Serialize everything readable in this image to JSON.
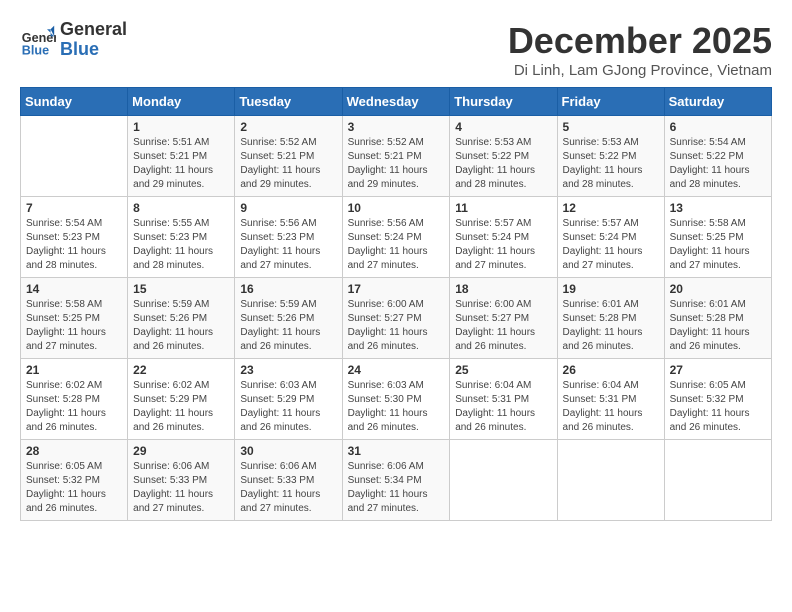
{
  "logo": {
    "general": "General",
    "blue": "Blue"
  },
  "title": "December 2025",
  "subtitle": "Di Linh, Lam GJong Province, Vietnam",
  "headers": [
    "Sunday",
    "Monday",
    "Tuesday",
    "Wednesday",
    "Thursday",
    "Friday",
    "Saturday"
  ],
  "weeks": [
    [
      {
        "day": "",
        "info": ""
      },
      {
        "day": "1",
        "info": "Sunrise: 5:51 AM\nSunset: 5:21 PM\nDaylight: 11 hours and 29 minutes."
      },
      {
        "day": "2",
        "info": "Sunrise: 5:52 AM\nSunset: 5:21 PM\nDaylight: 11 hours and 29 minutes."
      },
      {
        "day": "3",
        "info": "Sunrise: 5:52 AM\nSunset: 5:21 PM\nDaylight: 11 hours and 29 minutes."
      },
      {
        "day": "4",
        "info": "Sunrise: 5:53 AM\nSunset: 5:22 PM\nDaylight: 11 hours and 28 minutes."
      },
      {
        "day": "5",
        "info": "Sunrise: 5:53 AM\nSunset: 5:22 PM\nDaylight: 11 hours and 28 minutes."
      },
      {
        "day": "6",
        "info": "Sunrise: 5:54 AM\nSunset: 5:22 PM\nDaylight: 11 hours and 28 minutes."
      }
    ],
    [
      {
        "day": "7",
        "info": "Sunrise: 5:54 AM\nSunset: 5:23 PM\nDaylight: 11 hours and 28 minutes."
      },
      {
        "day": "8",
        "info": "Sunrise: 5:55 AM\nSunset: 5:23 PM\nDaylight: 11 hours and 28 minutes."
      },
      {
        "day": "9",
        "info": "Sunrise: 5:56 AM\nSunset: 5:23 PM\nDaylight: 11 hours and 27 minutes."
      },
      {
        "day": "10",
        "info": "Sunrise: 5:56 AM\nSunset: 5:24 PM\nDaylight: 11 hours and 27 minutes."
      },
      {
        "day": "11",
        "info": "Sunrise: 5:57 AM\nSunset: 5:24 PM\nDaylight: 11 hours and 27 minutes."
      },
      {
        "day": "12",
        "info": "Sunrise: 5:57 AM\nSunset: 5:24 PM\nDaylight: 11 hours and 27 minutes."
      },
      {
        "day": "13",
        "info": "Sunrise: 5:58 AM\nSunset: 5:25 PM\nDaylight: 11 hours and 27 minutes."
      }
    ],
    [
      {
        "day": "14",
        "info": "Sunrise: 5:58 AM\nSunset: 5:25 PM\nDaylight: 11 hours and 27 minutes."
      },
      {
        "day": "15",
        "info": "Sunrise: 5:59 AM\nSunset: 5:26 PM\nDaylight: 11 hours and 26 minutes."
      },
      {
        "day": "16",
        "info": "Sunrise: 5:59 AM\nSunset: 5:26 PM\nDaylight: 11 hours and 26 minutes."
      },
      {
        "day": "17",
        "info": "Sunrise: 6:00 AM\nSunset: 5:27 PM\nDaylight: 11 hours and 26 minutes."
      },
      {
        "day": "18",
        "info": "Sunrise: 6:00 AM\nSunset: 5:27 PM\nDaylight: 11 hours and 26 minutes."
      },
      {
        "day": "19",
        "info": "Sunrise: 6:01 AM\nSunset: 5:28 PM\nDaylight: 11 hours and 26 minutes."
      },
      {
        "day": "20",
        "info": "Sunrise: 6:01 AM\nSunset: 5:28 PM\nDaylight: 11 hours and 26 minutes."
      }
    ],
    [
      {
        "day": "21",
        "info": "Sunrise: 6:02 AM\nSunset: 5:28 PM\nDaylight: 11 hours and 26 minutes."
      },
      {
        "day": "22",
        "info": "Sunrise: 6:02 AM\nSunset: 5:29 PM\nDaylight: 11 hours and 26 minutes."
      },
      {
        "day": "23",
        "info": "Sunrise: 6:03 AM\nSunset: 5:29 PM\nDaylight: 11 hours and 26 minutes."
      },
      {
        "day": "24",
        "info": "Sunrise: 6:03 AM\nSunset: 5:30 PM\nDaylight: 11 hours and 26 minutes."
      },
      {
        "day": "25",
        "info": "Sunrise: 6:04 AM\nSunset: 5:31 PM\nDaylight: 11 hours and 26 minutes."
      },
      {
        "day": "26",
        "info": "Sunrise: 6:04 AM\nSunset: 5:31 PM\nDaylight: 11 hours and 26 minutes."
      },
      {
        "day": "27",
        "info": "Sunrise: 6:05 AM\nSunset: 5:32 PM\nDaylight: 11 hours and 26 minutes."
      }
    ],
    [
      {
        "day": "28",
        "info": "Sunrise: 6:05 AM\nSunset: 5:32 PM\nDaylight: 11 hours and 26 minutes."
      },
      {
        "day": "29",
        "info": "Sunrise: 6:06 AM\nSunset: 5:33 PM\nDaylight: 11 hours and 27 minutes."
      },
      {
        "day": "30",
        "info": "Sunrise: 6:06 AM\nSunset: 5:33 PM\nDaylight: 11 hours and 27 minutes."
      },
      {
        "day": "31",
        "info": "Sunrise: 6:06 AM\nSunset: 5:34 PM\nDaylight: 11 hours and 27 minutes."
      },
      {
        "day": "",
        "info": ""
      },
      {
        "day": "",
        "info": ""
      },
      {
        "day": "",
        "info": ""
      }
    ]
  ]
}
